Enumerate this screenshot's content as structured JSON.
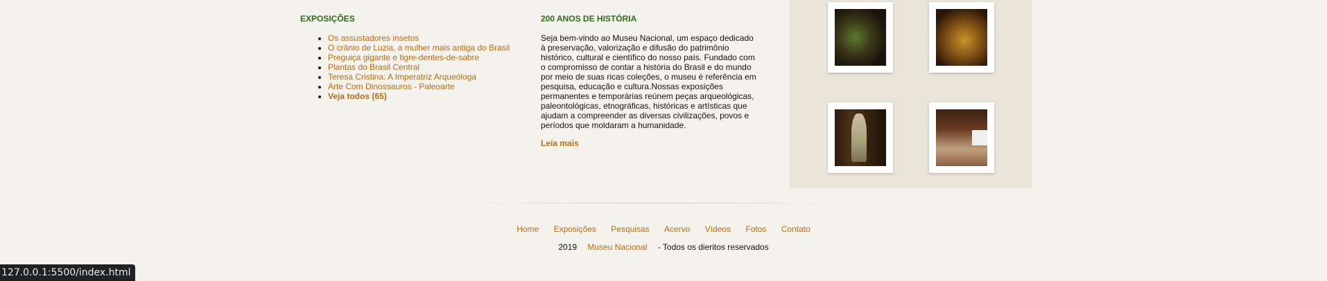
{
  "exposicoes": {
    "title": "EXPOSIÇÕES",
    "items": [
      "Os assustadores insetos",
      "O crânio de Luzia, a mulher mais antiga do Brasil",
      "Preguiça gigante e tigre-dentes-de-sabre",
      "Plantas do Brasil Central",
      "Teresa Cristina: A Imperatriz Arqueóloga",
      "Arte Com Dinossauros - Paleoarte"
    ],
    "see_all": "Veja todos (65)"
  },
  "historia": {
    "title": "200 ANOS DE HISTÓRIA",
    "body": "Seja bem-vindo ao Museu Nacional, um espaço dedicado à preservação, valorização e difusão do patrimônio histórico, cultural e científico do nosso país. Fundado com o compromisso de contar a história do Brasil e do mundo por meio de suas ricas coleções, o museu é referência em pesquisa, educação e cultura.Nossas exposições permanentes e temporárias reúnem peças arqueológicas, paleontológicas, etnográficas, históricas e artísticas que ajudam a compreender as diversas civilizações, povos e períodos que moldaram a humanidade.",
    "read_more": "Leia mais"
  },
  "gallery": {
    "photos": [
      "exhibit-hall-green",
      "exhibit-hall-gold",
      "dress-display",
      "exhibit-wall"
    ]
  },
  "footer": {
    "nav": [
      "Home",
      "Exposições",
      "Pesquisas",
      "Acervo",
      "Vídeos",
      "Fotos",
      "Contato"
    ],
    "year": "2019",
    "museum_link": "Museu Nacional",
    "rights": "- Todos os dieritos reservados"
  },
  "status_bar": {
    "url": "127.0.0.1:5500/index.html"
  },
  "colors": {
    "accent": "#b76d12",
    "heading": "#2e6a1a",
    "background": "#f4f2ec",
    "panel": "#e8e4d8"
  }
}
